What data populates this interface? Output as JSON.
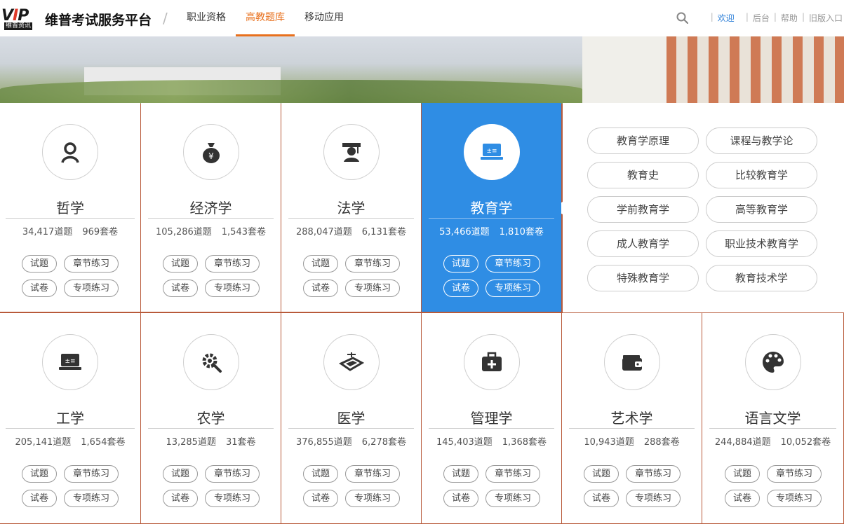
{
  "header": {
    "logo_text": "VIP",
    "logo_sub": "维普资讯",
    "site_title": "维普考试服务平台",
    "nav": [
      {
        "label": "职业资格",
        "active": false
      },
      {
        "label": "高教题库",
        "active": true
      },
      {
        "label": "移动应用",
        "active": false
      }
    ],
    "links": {
      "welcome": "欢迎",
      "admin": "后台",
      "help": "帮助",
      "old": "旧版入口"
    },
    "accent_color": "#e8701d",
    "link_color": "#2d7fd8"
  },
  "categories": [
    {
      "name": "哲学",
      "questions": "34,417道题",
      "papers": "969套卷",
      "icon": "person-icon"
    },
    {
      "name": "经济学",
      "questions": "105,286道题",
      "papers": "1,543套卷",
      "icon": "money-bag-icon"
    },
    {
      "name": "法学",
      "questions": "288,047道题",
      "papers": "6,131套卷",
      "icon": "judge-icon"
    },
    {
      "name": "教育学",
      "questions": "53,466道题",
      "papers": "1,810套卷",
      "icon": "laptop-icon",
      "active": true
    },
    {
      "name": "工学",
      "questions": "205,141道题",
      "papers": "1,654套卷",
      "icon": "laptop-icon"
    },
    {
      "name": "农学",
      "questions": "13,285道题",
      "papers": "31套卷",
      "icon": "gear-tools-icon"
    },
    {
      "name": "医学",
      "questions": "376,855道题",
      "papers": "6,278套卷",
      "icon": "scale-icon"
    },
    {
      "name": "管理学",
      "questions": "145,403道题",
      "papers": "1,368套卷",
      "icon": "medkit-icon"
    },
    {
      "name": "艺术学",
      "questions": "10,943道题",
      "papers": "288套卷",
      "icon": "wallet-icon"
    },
    {
      "name": "语言文学",
      "questions": "244,884道题",
      "papers": "10,052套卷",
      "icon": "palette-icon"
    }
  ],
  "actions": {
    "questions": "试题",
    "chapter": "章节练习",
    "paper": "试卷",
    "special": "专项练习"
  },
  "subcategories": [
    "教育学原理",
    "课程与教学论",
    "教育史",
    "比较教育学",
    "学前教育学",
    "高等教育学",
    "成人教育学",
    "职业技术教育学",
    "特殊教育学",
    "教育技术学"
  ],
  "active_color": "#2f8de4"
}
